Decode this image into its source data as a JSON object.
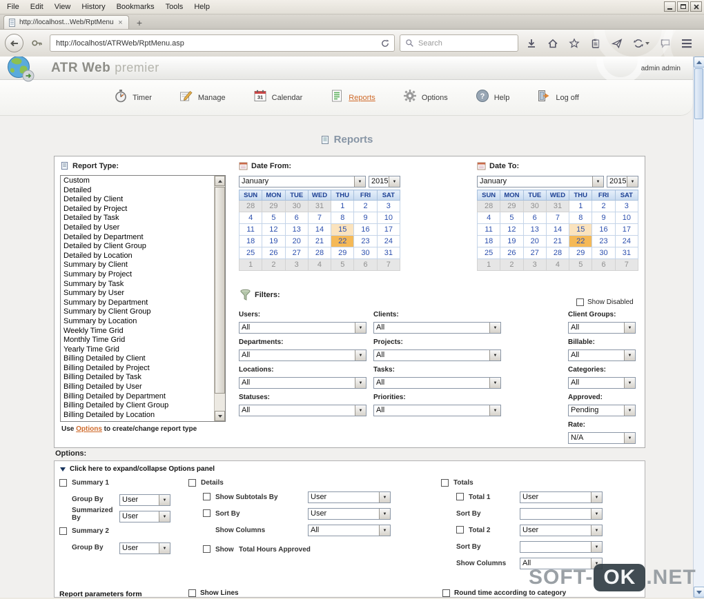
{
  "browser": {
    "menu": [
      "File",
      "Edit",
      "View",
      "History",
      "Bookmarks",
      "Tools",
      "Help"
    ],
    "tab": {
      "title": "http://localhost...Web/RptMenu.asp"
    },
    "urlbar": {
      "value": "http://localhost/ATRWeb/RptMenu.asp"
    },
    "search": {
      "placeholder": "Search"
    }
  },
  "glyphs": {
    "close": "×",
    "new_tab": "+",
    "dropdown": "▼"
  },
  "app": {
    "title": "ATR Web",
    "title_suffix": "premier",
    "user": "admin admin",
    "nav": [
      {
        "id": "timer",
        "label": "Timer",
        "active": false
      },
      {
        "id": "manage",
        "label": "Manage",
        "active": false
      },
      {
        "id": "calendar",
        "label": "Calendar",
        "active": false
      },
      {
        "id": "reports",
        "label": "Reports",
        "active": true
      },
      {
        "id": "options",
        "label": "Options",
        "active": false
      },
      {
        "id": "help",
        "label": "Help",
        "active": false
      },
      {
        "id": "logoff",
        "label": "Log off",
        "active": false
      }
    ],
    "page_title": "Reports"
  },
  "report_type": {
    "label": "Report Type:",
    "items": [
      "Custom",
      "Detailed",
      "Detailed by Client",
      "Detailed by Project",
      "Detailed by Task",
      "Detailed by User",
      "Detailed by Department",
      "Detailed by Client Group",
      "Detailed by Location",
      "Summary by Client",
      "Summary by Project",
      "Summary by Task",
      "Summary by User",
      "Summary by Department",
      "Summary by Client Group",
      "Summary by Location",
      "Weekly Time Grid",
      "Monthly Time Grid",
      "Yearly Time Grid",
      "Billing Detailed by Client",
      "Billing Detailed by Project",
      "Billing Detailed by Task",
      "Billing Detailed by User",
      "Billing Detailed by Department",
      "Billing Detailed by Client Group",
      "Billing Detailed by Location"
    ],
    "hint_prefix": "Use ",
    "hint_link": "Options",
    "hint_suffix": " to create/change report type"
  },
  "date_from": {
    "label": "Date From:",
    "month": "January",
    "year": "2015"
  },
  "date_to": {
    "label": "Date To:",
    "month": "January",
    "year": "2015"
  },
  "calendar": {
    "day_headers": [
      "SUN",
      "MON",
      "TUE",
      "WED",
      "THU",
      "FRI",
      "SAT"
    ],
    "weeks": [
      [
        {
          "d": "28",
          "s": "m"
        },
        {
          "d": "29",
          "s": "m"
        },
        {
          "d": "30",
          "s": "m"
        },
        {
          "d": "31",
          "s": "m"
        },
        {
          "d": "1"
        },
        {
          "d": "2"
        },
        {
          "d": "3"
        }
      ],
      [
        {
          "d": "4"
        },
        {
          "d": "5"
        },
        {
          "d": "6"
        },
        {
          "d": "7"
        },
        {
          "d": "8"
        },
        {
          "d": "9"
        },
        {
          "d": "10"
        }
      ],
      [
        {
          "d": "11"
        },
        {
          "d": "12"
        },
        {
          "d": "13"
        },
        {
          "d": "14"
        },
        {
          "d": "15",
          "s": "t"
        },
        {
          "d": "16"
        },
        {
          "d": "17"
        }
      ],
      [
        {
          "d": "18"
        },
        {
          "d": "19"
        },
        {
          "d": "20"
        },
        {
          "d": "21"
        },
        {
          "d": "22",
          "s": "sel"
        },
        {
          "d": "23"
        },
        {
          "d": "24"
        }
      ],
      [
        {
          "d": "25"
        },
        {
          "d": "26"
        },
        {
          "d": "27"
        },
        {
          "d": "28"
        },
        {
          "d": "29"
        },
        {
          "d": "30"
        },
        {
          "d": "31"
        }
      ],
      [
        {
          "d": "1",
          "s": "m"
        },
        {
          "d": "2",
          "s": "m"
        },
        {
          "d": "3",
          "s": "m"
        },
        {
          "d": "4",
          "s": "m"
        },
        {
          "d": "5",
          "s": "m"
        },
        {
          "d": "6",
          "s": "m"
        },
        {
          "d": "7",
          "s": "m"
        }
      ]
    ]
  },
  "filters": {
    "label": "Filters:",
    "show_disabled": "Show Disabled",
    "fields": [
      {
        "id": "users",
        "label": "Users:",
        "value": "All"
      },
      {
        "id": "clients",
        "label": "Clients:",
        "value": "All"
      },
      {
        "id": "client-groups",
        "label": "Client Groups:",
        "value": "All"
      },
      {
        "id": "departments",
        "label": "Departments:",
        "value": "All"
      },
      {
        "id": "projects",
        "label": "Projects:",
        "value": "All"
      },
      {
        "id": "billable",
        "label": "Billable:",
        "value": "All"
      },
      {
        "id": "locations",
        "label": "Locations:",
        "value": "All"
      },
      {
        "id": "tasks",
        "label": "Tasks:",
        "value": "All"
      },
      {
        "id": "categories",
        "label": "Categories:",
        "value": "All"
      },
      {
        "id": "statuses",
        "label": "Statuses:",
        "value": "All"
      },
      {
        "id": "priorities",
        "label": "Priorities:",
        "value": "All"
      },
      {
        "id": "approved",
        "label": "Approved:",
        "value": "Pending"
      }
    ],
    "rate": {
      "id": "rate",
      "label": "Rate:",
      "value": "N/A"
    }
  },
  "options_panel": {
    "label": "Options:",
    "expand_text": "Click here to expand/collapse Options panel",
    "summary1": {
      "title": "Summary 1",
      "group_by_label": "Group By",
      "group_by_value": "User",
      "summarized_by_label": "Summarized By",
      "summarized_by_value": "User"
    },
    "summary2": {
      "title": "Summary 2",
      "group_by_label": "Group By",
      "group_by_value": "User"
    },
    "details": {
      "title": "Details",
      "rows": [
        {
          "id": "show-subtotals-by",
          "label": "Show Subtotals By",
          "value": "User",
          "checkbox": true
        },
        {
          "id": "sort-by",
          "label": "Sort By",
          "value": "User",
          "checkbox": true
        },
        {
          "id": "show-columns",
          "label": "Show Columns",
          "value": "All",
          "checkbox": false
        }
      ],
      "show_row": {
        "label": "Show",
        "extra": "Total Hours Approved"
      }
    },
    "totals": {
      "title": "Totals",
      "rows": [
        {
          "id": "total-1",
          "label": "Total 1",
          "value": "User",
          "checkbox": true
        },
        {
          "id": "sort-by-1",
          "label": "Sort By",
          "value": "",
          "checkbox": false
        },
        {
          "id": "total-2",
          "label": "Total 2",
          "value": "User",
          "checkbox": true
        },
        {
          "id": "sort-by-2",
          "label": "Sort By",
          "value": "",
          "checkbox": false
        },
        {
          "id": "show-columns",
          "label": "Show Columns",
          "value": "All",
          "checkbox": false
        }
      ]
    },
    "bottom": {
      "report_params": "Report parameters form",
      "show_lines": "Show Lines",
      "round_time": "Round time according to category"
    }
  },
  "watermark": {
    "prefix": "SOFT-",
    "boxed": "OK",
    "suffix": ".NET"
  }
}
